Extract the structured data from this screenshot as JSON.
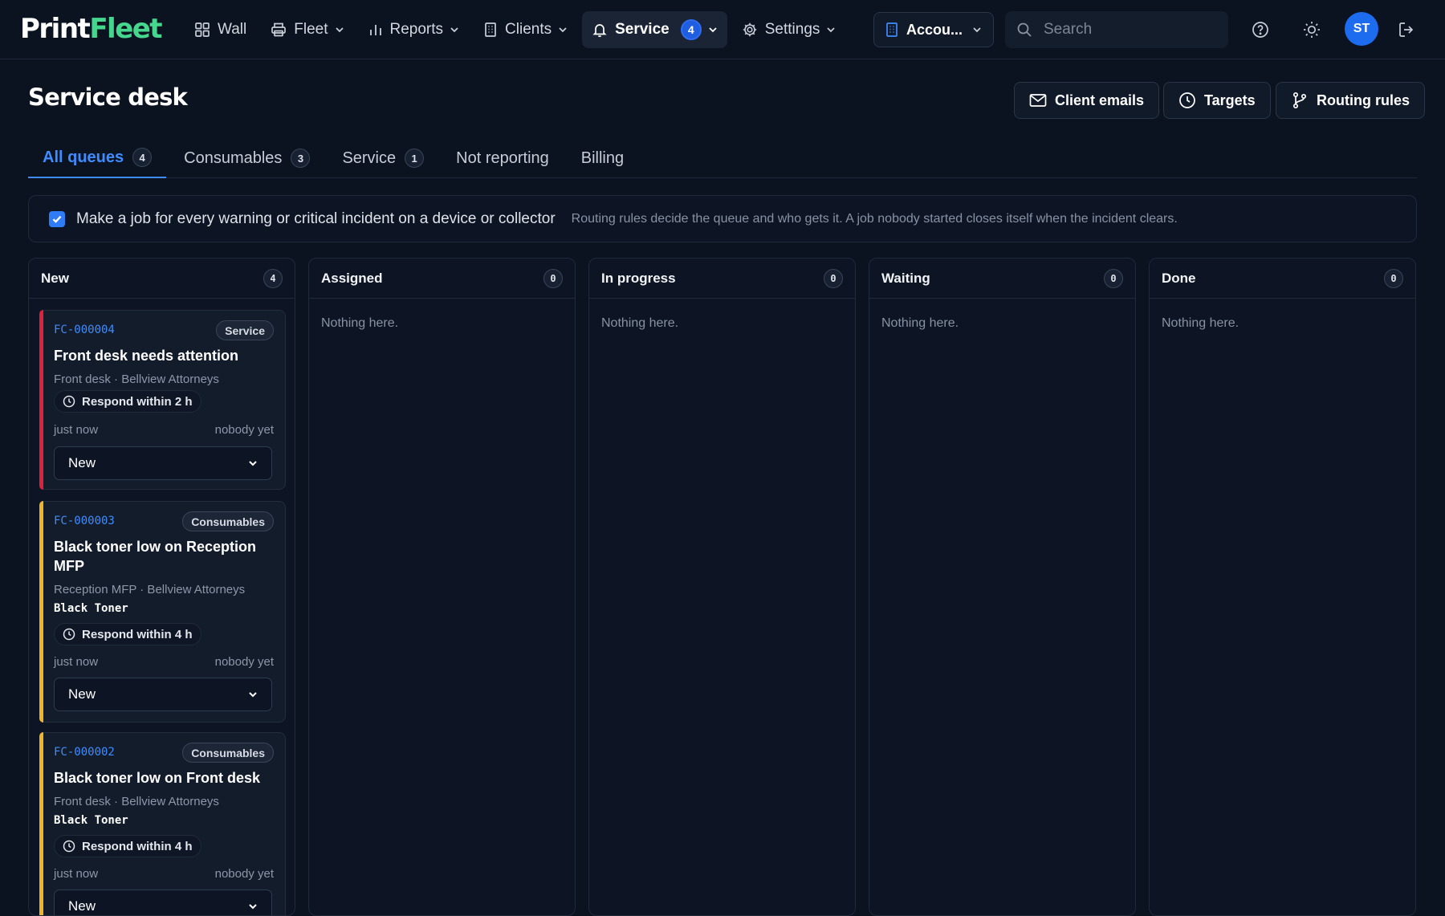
{
  "brand": {
    "part1": "Print",
    "part2": "Fleet"
  },
  "nav": {
    "wall": "Wall",
    "fleet": "Fleet",
    "reports": "Reports",
    "clients": "Clients",
    "service": "Service",
    "service_badge": "4",
    "settings": "Settings"
  },
  "account": {
    "label": "Accou..."
  },
  "search": {
    "placeholder": "Search"
  },
  "user": {
    "initials": "ST"
  },
  "page": {
    "title": "Service desk"
  },
  "header_buttons": {
    "client_emails": "Client emails",
    "targets": "Targets",
    "routing_rules": "Routing rules"
  },
  "tabs": [
    {
      "label": "All queues",
      "count": "4"
    },
    {
      "label": "Consumables",
      "count": "3"
    },
    {
      "label": "Service",
      "count": "1"
    },
    {
      "label": "Not reporting"
    },
    {
      "label": "Billing"
    }
  ],
  "options": {
    "auto_job_label": "Make a job for every warning or critical incident on a device or collector",
    "auto_job_checked": true,
    "hint": "Routing rules decide the queue and who gets it. A job nobody started closes itself when the incident clears."
  },
  "columns": [
    {
      "title": "New",
      "count": "4"
    },
    {
      "title": "Assigned",
      "count": "0",
      "empty": "Nothing here."
    },
    {
      "title": "In progress",
      "count": "0",
      "empty": "Nothing here."
    },
    {
      "title": "Waiting",
      "count": "0",
      "empty": "Nothing here."
    },
    {
      "title": "Done",
      "count": "0",
      "empty": "Nothing here."
    }
  ],
  "cards": [
    {
      "id": "FC-000004",
      "tag": "Service",
      "title": "Front desk needs attention",
      "meta": "Front desk · Bellview Attorneys",
      "sla": "Respond within 2 h",
      "time": "just now",
      "assignee": "nobody yet",
      "status": "New",
      "severity_color": "#e0213c"
    },
    {
      "id": "FC-000003",
      "tag": "Consumables",
      "title": "Black toner low on Reception MFP",
      "meta": "Reception MFP · Bellview Attorneys",
      "kind": "Black Toner",
      "sla": "Respond within 4 h",
      "time": "just now",
      "assignee": "nobody yet",
      "status": "New",
      "severity_color": "#f0b429"
    },
    {
      "id": "FC-000002",
      "tag": "Consumables",
      "title": "Black toner low on Front desk",
      "meta": "Front desk · Bellview Attorneys",
      "kind": "Black Toner",
      "sla": "Respond within 4 h",
      "time": "just now",
      "assignee": "nobody yet",
      "status": "New",
      "severity_color": "#f0b429"
    }
  ],
  "colors": {
    "accent": "#3f8cff",
    "brand_green": "#46d78f",
    "background": "#0b1220"
  }
}
